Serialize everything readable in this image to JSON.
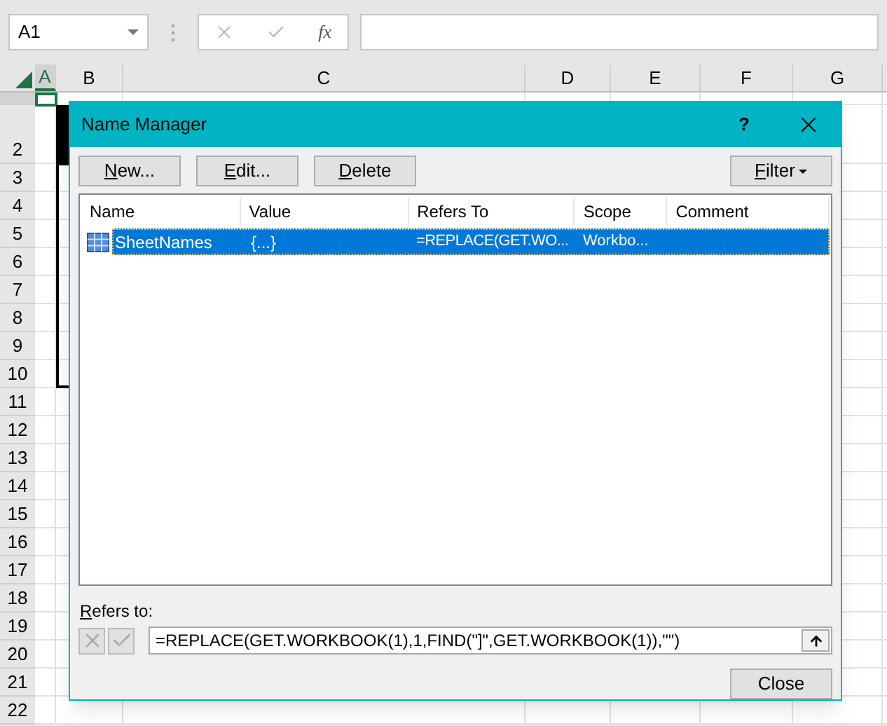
{
  "name_box": {
    "value": "A1"
  },
  "formula_bar": {
    "function_label": "fx"
  },
  "sheet": {
    "columns": [
      {
        "label": "A",
        "selected": true
      },
      {
        "label": "B",
        "selected": false
      },
      {
        "label": "C",
        "selected": false
      },
      {
        "label": "D",
        "selected": false
      },
      {
        "label": "E",
        "selected": false
      },
      {
        "label": "F",
        "selected": false
      },
      {
        "label": "G",
        "selected": false
      }
    ],
    "rows": [
      {
        "selected": true
      },
      {
        "label": "2",
        "selected": false
      },
      {
        "label": "3",
        "selected": false
      },
      {
        "label": "4",
        "selected": false
      },
      {
        "label": "5",
        "selected": false
      },
      {
        "label": "6",
        "selected": false
      },
      {
        "label": "7",
        "selected": false
      },
      {
        "label": "8",
        "selected": false
      },
      {
        "label": "9",
        "selected": false
      },
      {
        "label": "10",
        "selected": false
      },
      {
        "label": "11",
        "selected": false
      },
      {
        "label": "12",
        "selected": false
      },
      {
        "label": "13",
        "selected": false
      },
      {
        "label": "14",
        "selected": false
      },
      {
        "label": "15",
        "selected": false
      },
      {
        "label": "16",
        "selected": false
      },
      {
        "label": "17",
        "selected": false
      },
      {
        "label": "18",
        "selected": false
      },
      {
        "label": "19",
        "selected": false
      },
      {
        "label": "20",
        "selected": false
      },
      {
        "label": "21",
        "selected": false
      },
      {
        "label": "22",
        "selected": false
      }
    ]
  },
  "dialog": {
    "title": "Name Manager",
    "help": "?",
    "buttons": [
      {
        "hotkey": "N",
        "label_rest": "ew..."
      },
      {
        "hotkey": "E",
        "label_rest": "dit..."
      },
      {
        "hotkey": "D",
        "label_rest": "elete"
      }
    ],
    "filter_button": {
      "hotkey": "F",
      "label_rest": "ilter"
    },
    "table": {
      "columns": [
        "Name",
        "Value",
        "Refers To",
        "Scope",
        "Comment"
      ],
      "rows": [
        {
          "name": "SheetNames",
          "value": "{...}",
          "refers_to": "=REPLACE(GET.WO...",
          "scope": "Workbo...",
          "selected": true
        }
      ]
    },
    "refers_to_label": {
      "hotkey": "R",
      "label_rest": "efers to:"
    },
    "refers_to_value": "=REPLACE(GET.WORKBOOK(1),1,FIND(\"]\",GET.WORKBOOK(1)),\"\")",
    "close_button": "Close"
  }
}
